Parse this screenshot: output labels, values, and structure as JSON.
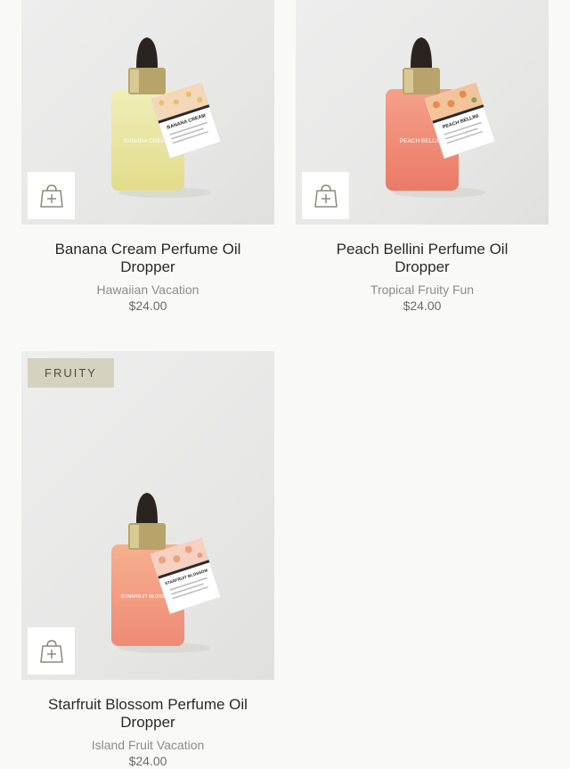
{
  "products": [
    {
      "title": "Banana Cream Perfume Oil Dropper",
      "collection": "Hawaiian Vacation",
      "price": "$24.00",
      "label_name": "BANANA CREAM",
      "tag_title": "BANANA CREAM",
      "bottle_color": "#e8e49a",
      "add_icon": "shopping-bag-plus-icon"
    },
    {
      "title": "Peach Bellini Perfume Oil Dropper",
      "collection": "Tropical Fruity Fun",
      "price": "$24.00",
      "label_name": "PEACH BELLINI",
      "tag_title": "PEACH BELLINI",
      "bottle_color": "#f08a74",
      "add_icon": "shopping-bag-plus-icon"
    },
    {
      "title": "Starfruit Blossom Perfume Oil Dropper",
      "collection": "Island Fruit Vacation",
      "price": "$24.00",
      "badge": "FRUITY",
      "label_name": "STARFRUIT BLOSSOM",
      "tag_title": "STARFRUIT BLOSSOM",
      "bottle_color": "#f09a80",
      "add_icon": "shopping-bag-plus-icon"
    }
  ],
  "colors": {
    "page_bg": "#f9f9f8",
    "badge_bg": "#d6d2c0",
    "icon_stroke": "#8a8a7c"
  }
}
